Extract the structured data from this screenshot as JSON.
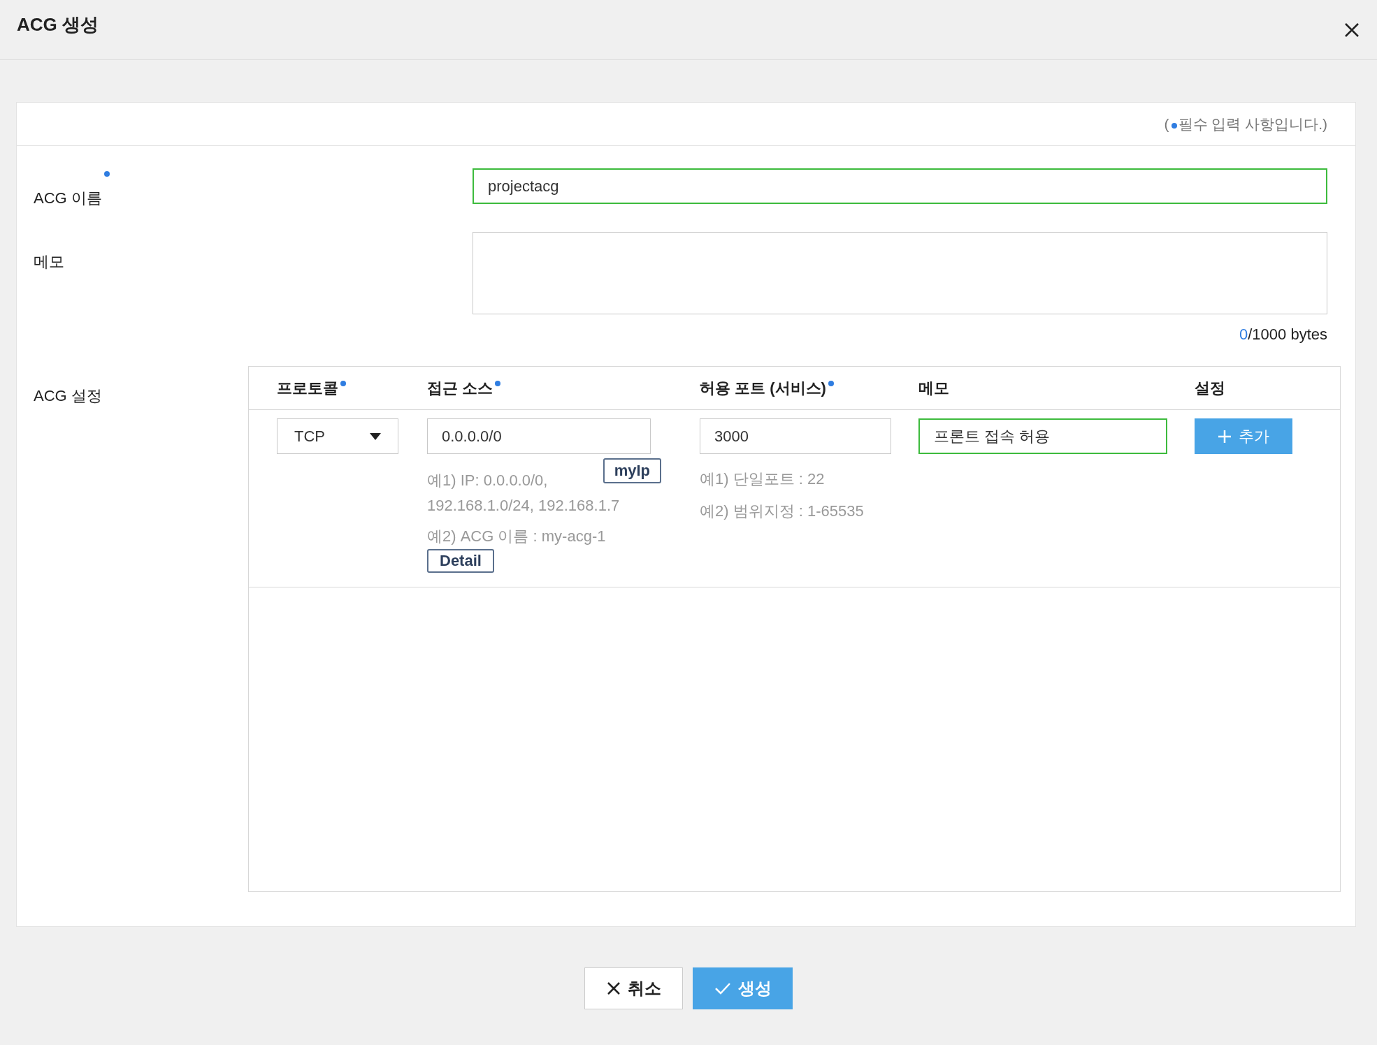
{
  "dialog": {
    "title": "ACG 생성"
  },
  "required_note": {
    "prefix": "(",
    "text": "필수 입력 사항입니다.)"
  },
  "fields": [
    {
      "kind": "input",
      "label": "ACG 이름",
      "required": true,
      "value": "projectacg",
      "focused": true
    },
    {
      "kind": "textarea",
      "label": "메모",
      "focused": false,
      "counter_used": "0",
      "counter_total": "/1000 bytes"
    }
  ],
  "acg_settings": {
    "label": "ACG 설정",
    "columns": [
      {
        "label": "프로토콜",
        "required": true
      },
      {
        "label": "접근 소스",
        "required": true
      },
      {
        "label": "허용 포트 (서비스)",
        "required": true
      },
      {
        "label": "메모"
      },
      {
        "label": "설정"
      }
    ],
    "protocol": {
      "value": "TCP"
    },
    "source": {
      "value": "0.0.0.0/0",
      "focused": false,
      "my_ip_button": "myIp",
      "hints": [
        "예1) IP: 0.0.0.0/0,",
        "192.168.1.0/24, 192.168.1.7",
        "예2) ACG 이름 : my-acg-1"
      ],
      "detail_button": "Detail"
    },
    "port": {
      "value": "3000",
      "focused": false,
      "hints": [
        "예1) 단일포트 : 22",
        "예2) 범위지정 : 1-65535"
      ]
    },
    "memo": {
      "value": "프론트 접속 허용",
      "focused": true
    },
    "add_button": "추가"
  },
  "footer": {
    "cancel": "취소",
    "create": "생성"
  }
}
